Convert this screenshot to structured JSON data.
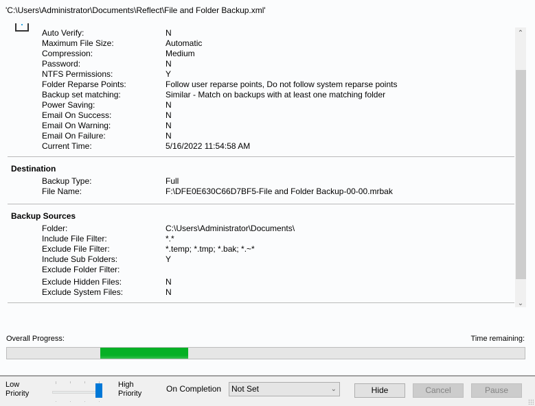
{
  "window": {
    "file_path": "'C:\\Users\\Administrator\\Documents\\Reflect\\File and Folder Backup.xml'"
  },
  "options": [
    {
      "label": "Auto Verify:",
      "value": "N"
    },
    {
      "label": "Maximum File Size:",
      "value": "Automatic"
    },
    {
      "label": "Compression:",
      "value": "Medium"
    },
    {
      "label": "Password:",
      "value": "N"
    },
    {
      "label": "NTFS Permissions:",
      "value": "Y"
    },
    {
      "label": "Folder Reparse Points:",
      "value": "Follow user reparse points, Do not follow system reparse points"
    },
    {
      "label": "Backup set matching:",
      "value": "Similar - Match on backups with at least one matching folder"
    },
    {
      "label": "Power Saving:",
      "value": "N"
    },
    {
      "label": "Email On Success:",
      "value": "N"
    },
    {
      "label": "Email On Warning:",
      "value": "N"
    },
    {
      "label": "Email On Failure:",
      "value": "N"
    },
    {
      "label": "Current Time:",
      "value": "5/16/2022 11:54:58 AM"
    }
  ],
  "destination": {
    "heading": "Destination",
    "rows": [
      {
        "label": "Backup Type:",
        "value": "Full"
      },
      {
        "label": "File Name:",
        "value": "F:\\DFE0E630C66D7BF5-File and Folder Backup-00-00.mrbak"
      }
    ]
  },
  "sources": {
    "heading": "Backup Sources",
    "rows": [
      {
        "label": "Folder:",
        "value": "C:\\Users\\Administrator\\Documents\\"
      },
      {
        "label": "Include File Filter:",
        "value": "*.*"
      },
      {
        "label": "Exclude File Filter:",
        "value": "*.temp; *.tmp; *.bak; *.~*"
      },
      {
        "label": "Include Sub Folders:",
        "value": "Y"
      },
      {
        "label": "Exclude Folder Filter:",
        "value": ""
      },
      {
        "label": "Exclude Hidden Files:",
        "value": "N"
      },
      {
        "label": "Exclude System Files:",
        "value": "N"
      }
    ]
  },
  "progress": {
    "label": "Overall Progress:",
    "time_remaining_label": "Time remaining:",
    "indeterminate_segment_start": 0.18,
    "indeterminate_segment_end": 0.35,
    "fill_color": "#06b025"
  },
  "scrollbar": {
    "thumb_start_fraction": 0.15,
    "thumb_end_fraction": 0.89
  },
  "priority": {
    "low_line1": "Low",
    "low_line2": "Priority",
    "high_line1": "High",
    "high_line2": "Priority",
    "slider_value_fraction": 1.0,
    "accent_color": "#0078d7"
  },
  "on_completion": {
    "label": "On Completion",
    "selected": "Not Set"
  },
  "buttons": {
    "hide": "Hide",
    "cancel": "Cancel",
    "pause": "Pause"
  }
}
